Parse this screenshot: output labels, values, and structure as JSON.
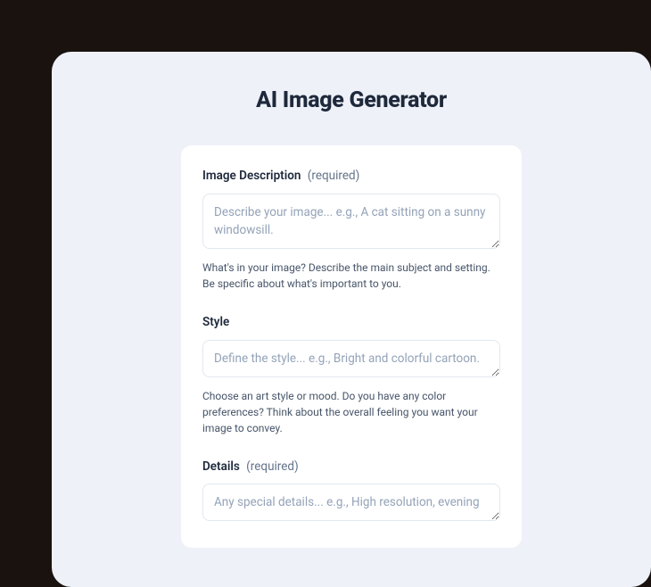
{
  "title": "AI Image Generator",
  "form": {
    "description": {
      "label": "Image Description",
      "required": "(required)",
      "placeholder": "Describe your image... e.g., A cat sitting on a sunny windowsill.",
      "helper": "What's in your image? Describe the main subject and setting. Be specific about what's important to you."
    },
    "style": {
      "label": "Style",
      "placeholder": "Define the style... e.g., Bright and colorful cartoon.",
      "helper": "Choose an art style or mood. Do you have any color preferences? Think about the overall feeling you want your image to convey."
    },
    "details": {
      "label": "Details",
      "required": "(required)",
      "placeholder": "Any special details... e.g., High resolution, evening"
    }
  }
}
